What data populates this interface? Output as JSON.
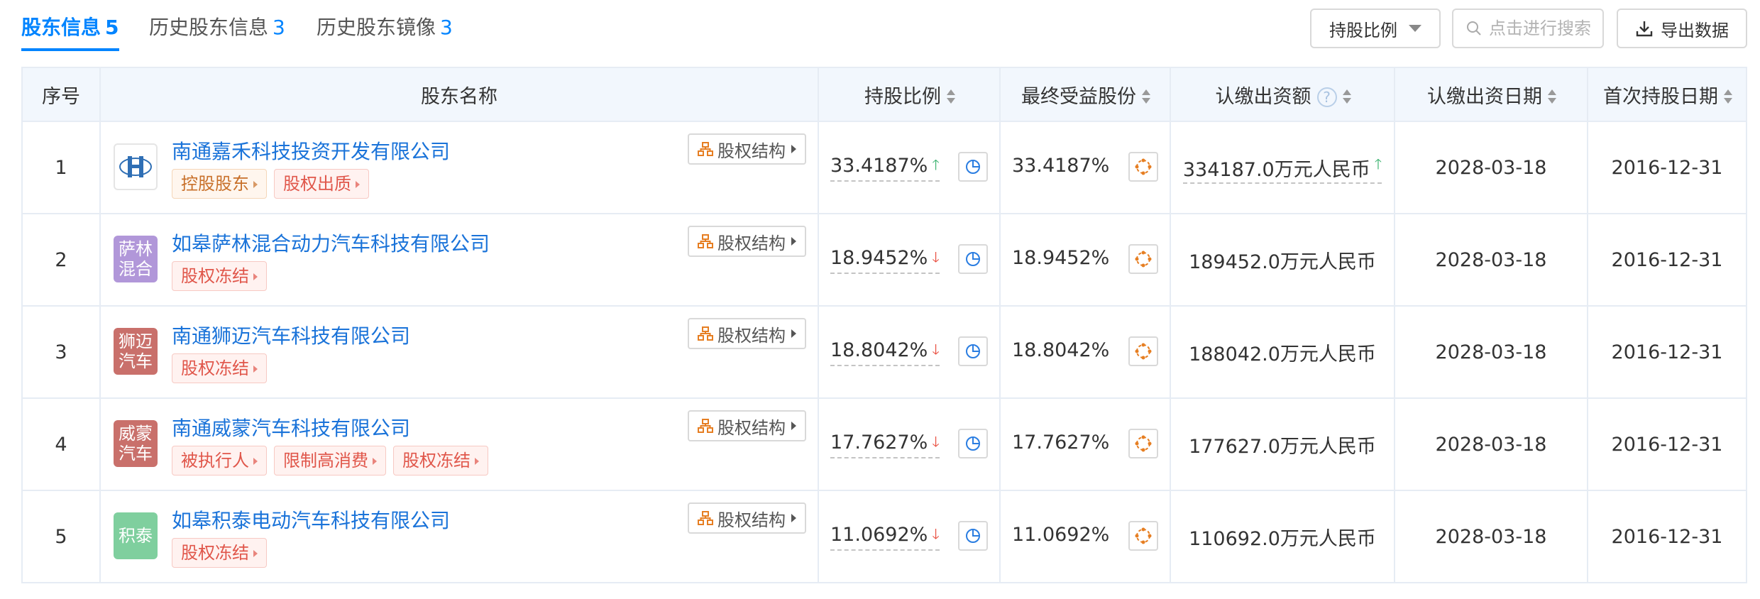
{
  "tabs": [
    {
      "label": "股东信息",
      "count": "5",
      "active": true
    },
    {
      "label": "历史股东信息",
      "count": "3",
      "active": false
    },
    {
      "label": "历史股东镜像",
      "count": "3",
      "active": false
    }
  ],
  "toolbar": {
    "ratio_label": "持股比例",
    "search_placeholder": "点击进行搜索",
    "export_label": "导出数据"
  },
  "table": {
    "headers": {
      "index": "序号",
      "name": "股东名称",
      "ratio": "持股比例",
      "benefit": "最终受益股份",
      "capital": "认缴出资额",
      "capital_date": "认缴出资日期",
      "first_date": "首次持股日期"
    },
    "equity_button": "股权结构",
    "rows": [
      {
        "index": "1",
        "logo_text": "",
        "logo_color": "#ffffff",
        "company": "南通嘉禾科技投资开发有限公司",
        "tags": [
          {
            "label": "控股股东",
            "style": "orange"
          },
          {
            "label": "股权出质",
            "style": "red"
          }
        ],
        "ratio": "33.4187%",
        "ratio_trend": "up",
        "benefit": "33.4187%",
        "capital": "334187.0万元人民币",
        "capital_trend": "up",
        "capital_date": "2028-03-18",
        "first_date": "2016-12-31"
      },
      {
        "index": "2",
        "logo_text": "萨林混合",
        "logo_color": "#b197d9",
        "company": "如皋萨林混合动力汽车科技有限公司",
        "tags": [
          {
            "label": "股权冻结",
            "style": "red"
          }
        ],
        "ratio": "18.9452%",
        "ratio_trend": "down",
        "benefit": "18.9452%",
        "capital": "189452.0万元人民币",
        "capital_trend": "",
        "capital_date": "2028-03-18",
        "first_date": "2016-12-31"
      },
      {
        "index": "3",
        "logo_text": "狮迈汽车",
        "logo_color": "#c9706b",
        "company": "南通狮迈汽车科技有限公司",
        "tags": [
          {
            "label": "股权冻结",
            "style": "red"
          }
        ],
        "ratio": "18.8042%",
        "ratio_trend": "down",
        "benefit": "18.8042%",
        "capital": "188042.0万元人民币",
        "capital_trend": "",
        "capital_date": "2028-03-18",
        "first_date": "2016-12-31"
      },
      {
        "index": "4",
        "logo_text": "威蒙汽车",
        "logo_color": "#c9706b",
        "company": "南通威蒙汽车科技有限公司",
        "tags": [
          {
            "label": "被执行人",
            "style": "red"
          },
          {
            "label": "限制高消费",
            "style": "red"
          },
          {
            "label": "股权冻结",
            "style": "red"
          }
        ],
        "ratio": "17.7627%",
        "ratio_trend": "down",
        "benefit": "17.7627%",
        "capital": "177627.0万元人民币",
        "capital_trend": "",
        "capital_date": "2028-03-18",
        "first_date": "2016-12-31"
      },
      {
        "index": "5",
        "logo_text": "积泰",
        "logo_color": "#7fcf9e",
        "company": "如皋积泰电动汽车科技有限公司",
        "tags": [
          {
            "label": "股权冻结",
            "style": "red"
          }
        ],
        "ratio": "11.0692%",
        "ratio_trend": "down",
        "benefit": "11.0692%",
        "capital": "110692.0万元人民币",
        "capital_trend": "",
        "capital_date": "2028-03-18",
        "first_date": "2016-12-31"
      }
    ]
  }
}
